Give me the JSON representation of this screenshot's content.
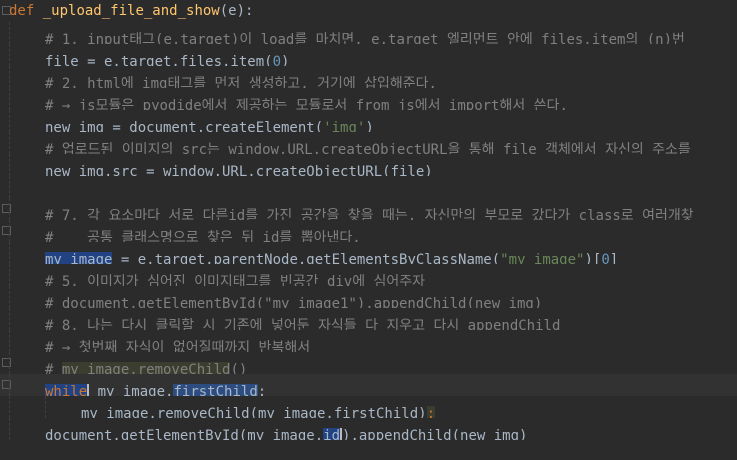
{
  "editor": {
    "lines": [
      {
        "id": "l1",
        "text_def": "def",
        "text_name": "_upload_file_and_show",
        "text_rest": "(e):"
      },
      {
        "id": "l2",
        "text": "# 1. input태그(e.target)이 load를 마치면, e.target 엘리먼트 안에 files.item의 (n)번"
      },
      {
        "id": "l3",
        "text_a": "file = e.target.files.item(",
        "text_num": "0",
        "text_b": ")"
      },
      {
        "id": "l4",
        "text": "# 2. html에 img태그를 먼저 생성하고, 거기에 삽입해준다."
      },
      {
        "id": "l5",
        "text": "# → js모듈은 pyodide에서 제공하는 모듈로서 from js에서 import해서 쓴다."
      },
      {
        "id": "l6",
        "text_a": "new_img = document.createElement(",
        "text_str": "'img'",
        "text_b": ")"
      },
      {
        "id": "l7",
        "text": "# 업로드된 이미지의 src는 window.URL.createObjectURL을 통해 file 객체에서 자신의 주소를"
      },
      {
        "id": "l8",
        "text": "new_img.src = window.URL.createObjectURL(file)"
      },
      {
        "id": "l9",
        "text": ""
      },
      {
        "id": "l10",
        "text": "# 7. 각 요소마다 서로 다른id를 가진 공간을 찾을 때는, 자신만의 부모로 갔다가 class로 여러개찾"
      },
      {
        "id": "l11",
        "text": "#    공통 클래스명으로 찾은 뒤 id를 뽑아낸다."
      },
      {
        "id": "l12",
        "text_sel": "my_image",
        "text_a": " = e.target.parentNode.getElementsByClassName(",
        "text_str": "\"my_image\"",
        "text_b": ")[",
        "text_num": "0",
        "text_c": "]"
      },
      {
        "id": "l13",
        "text": "# 5. 이미지가 심어진 이미지태그를 빈공간 div에 심어주자"
      },
      {
        "id": "l14",
        "text": "# document.getElementById(\"my_image1\").appendChild(new_img)"
      },
      {
        "id": "l15",
        "text": "# 8. 나는 다시 클릭할 시 기존에 넣어둔 자식들 다 지우고 다시 appendChild"
      },
      {
        "id": "l16",
        "text": "# → 첫번째 자식이 없어질때까지 반복해서"
      },
      {
        "id": "l17",
        "text_hash": "# ",
        "text_hl": "my_image.removeChild",
        "text_rest": "()"
      },
      {
        "id": "l18",
        "text_kw": "while",
        "text_a": " ",
        "text_obj": "my_image",
        "text_dot": ".",
        "text_attr": "firstChild",
        "text_b": ":"
      },
      {
        "id": "l19",
        "text": "my_image.removeChild(my_image.firstChild)",
        "text_semi": ";"
      },
      {
        "id": "l20",
        "text_a": "document.getElementById(my_image.",
        "text_id": "id",
        "text_b": ").appendChild(new_img)"
      }
    ]
  },
  "colors": {
    "background": "#2b2b2b",
    "keyword": "#cc7832",
    "function": "#ffc66d",
    "comment": "#808080",
    "string": "#6a8759",
    "number": "#6897bb",
    "text": "#a9b7c6",
    "selection": "#214283"
  }
}
